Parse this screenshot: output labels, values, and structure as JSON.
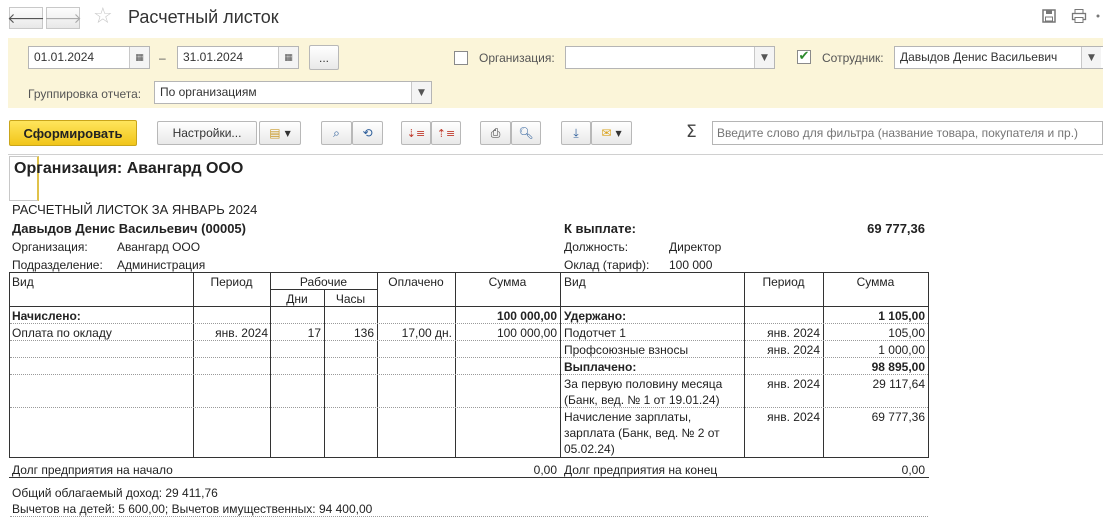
{
  "window": {
    "title": "Расчетный листок"
  },
  "icons": {
    "back": "arrow-left-icon",
    "forward": "arrow-right-icon",
    "favorite": "star-icon",
    "save": "save-icon",
    "print": "printer-icon",
    "more": "more-icon"
  },
  "params": {
    "date_from": "01.01.2024",
    "dash": "–",
    "date_to": "31.01.2024",
    "period_btn": "...",
    "org_label": "Организация:",
    "org_value": "",
    "org_checked": false,
    "employee_label": "Сотрудник:",
    "employee_value": "Давыдов Денис Васильевич",
    "employee_checked": true,
    "grouping_label": "Группировка отчета:",
    "grouping_value": "По организациям"
  },
  "toolbar": {
    "generate": "Сформировать",
    "settings": "Настройки...",
    "sigma": "Σ",
    "search_placeholder": "Введите слово для фильтра (название товара, покупателя и пр.)"
  },
  "report": {
    "org_heading": "Организация: Авангард ООО",
    "sheet_title": "РАСЧЕТНЫЙ ЛИСТОК ЗА ЯНВАРЬ 2024",
    "employee": "Давыдов Денис Васильевич (00005)",
    "payable_label": "К выплате:",
    "payable_value": "69 777,36",
    "org_label": "Организация:",
    "org_value": "Авангард ООО",
    "dept_label": "Подразделение:",
    "dept_value": "Администрация",
    "position_label": "Должность:",
    "position_value": "Директор",
    "salary_label": "Оклад (тариф):",
    "salary_value": "100 000",
    "left_headers": {
      "kind": "Вид",
      "period": "Период",
      "working": "Рабочие",
      "days": "Дни",
      "hours": "Часы",
      "paid": "Оплачено",
      "sum": "Сумма"
    },
    "right_headers": {
      "kind": "Вид",
      "period": "Период",
      "sum": "Сумма"
    },
    "accrued_label": "Начислено:",
    "accrued_total": "100 000,00",
    "accrual_row": {
      "kind": "Оплата по окладу",
      "period": "янв. 2024",
      "days": "17",
      "hours": "136",
      "paid": "17,00 дн.",
      "sum": "100 000,00"
    },
    "withheld_label": "Удержано:",
    "withheld_total": "1 105,00",
    "withheld_rows": [
      {
        "kind": "Подотчет 1",
        "period": "янв. 2024",
        "sum": "105,00"
      },
      {
        "kind": "Профсоюзные взносы",
        "period": "янв. 2024",
        "sum": "1 000,00"
      }
    ],
    "paid_label": "Выплачено:",
    "paid_total": "98 895,00",
    "paid_rows": [
      {
        "kind_line1": "За первую половину месяца",
        "kind_line2": "(Банк, вед. № 1 от 19.01.24)",
        "period": "янв. 2024",
        "sum": "29 117,64"
      },
      {
        "kind_line1": "Начисление зарплаты,",
        "kind_line2": "зарплата (Банк, вед. № 2 от",
        "kind_line3": "05.02.24)",
        "period": "янв. 2024",
        "sum": "69 777,36"
      }
    ],
    "debt_start_label": "Долг предприятия на начало",
    "debt_start_value": "0,00",
    "debt_end_label": "Долг предприятия на конец",
    "debt_end_value": "0,00",
    "taxable_income": "Общий облагаемый доход: 29 411,76",
    "deductions": "Вычетов на детей: 5 600,00; Вычетов имущественных: 94 400,00"
  }
}
